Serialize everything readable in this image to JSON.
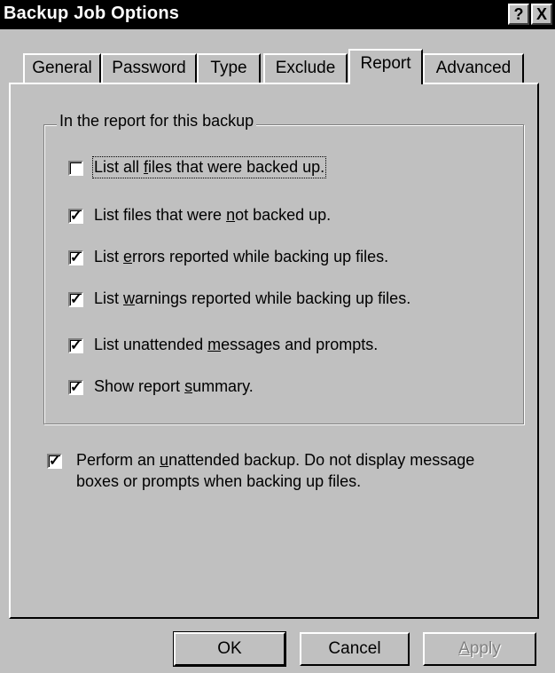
{
  "window": {
    "title": "Backup Job Options",
    "help_label": "?",
    "close_label": "X"
  },
  "tabs": [
    {
      "label": "General",
      "active": false
    },
    {
      "label": "Password",
      "active": false
    },
    {
      "label": "Type",
      "active": false
    },
    {
      "label": "Exclude",
      "active": false
    },
    {
      "label": "Report",
      "active": true
    },
    {
      "label": "Advanced",
      "active": false
    }
  ],
  "report_group": {
    "legend": "In the report for this backup",
    "options": [
      {
        "pre": "List all ",
        "mn": "f",
        "post": "iles that were backed up.",
        "checked": false
      },
      {
        "pre": "List files that were ",
        "mn": "n",
        "post": "ot backed up.",
        "checked": true
      },
      {
        "pre": "List ",
        "mn": "e",
        "post": "rrors reported while backing up files.",
        "checked": true
      },
      {
        "pre": "List ",
        "mn": "w",
        "post": "arnings reported while backing up files.",
        "checked": true
      },
      {
        "pre": "List unattended ",
        "mn": "m",
        "post": "essages and prompts.",
        "checked": true
      },
      {
        "pre": "Show report ",
        "mn": "s",
        "post": "ummary.",
        "checked": true
      }
    ]
  },
  "unattended": {
    "line1_pre": "Perform an ",
    "line1_mn": "u",
    "line1_post": "nattended backup.  Do not display message",
    "line2": "boxes or prompts when backing up files.",
    "checked": true
  },
  "buttons": {
    "ok": "OK",
    "cancel": "Cancel",
    "apply_mn": "A",
    "apply_rest": "pply"
  },
  "check_mark": "✓"
}
